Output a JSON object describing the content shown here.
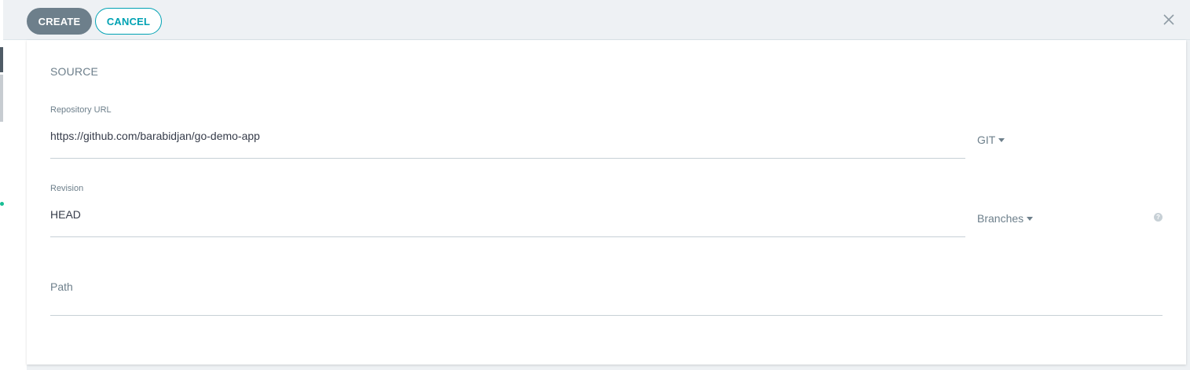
{
  "toolbar": {
    "create_label": "CREATE",
    "cancel_label": "CANCEL"
  },
  "source": {
    "section_title": "SOURCE",
    "repository_url": {
      "label": "Repository URL",
      "value": "https://github.com/barabidjan/go-demo-app",
      "type_dropdown": "GIT"
    },
    "revision": {
      "label": "Revision",
      "value": "HEAD",
      "type_dropdown": "Branches",
      "help_icon": "question-icon"
    },
    "path": {
      "placeholder": "Path",
      "value": ""
    }
  },
  "colors": {
    "accent": "#00a2b3",
    "create_button": "#6d7f8b",
    "text_muted": "#6d7f8b",
    "text_value": "#363c4a"
  },
  "icons": {
    "close": "close-icon",
    "caret": "caret-down-icon"
  }
}
